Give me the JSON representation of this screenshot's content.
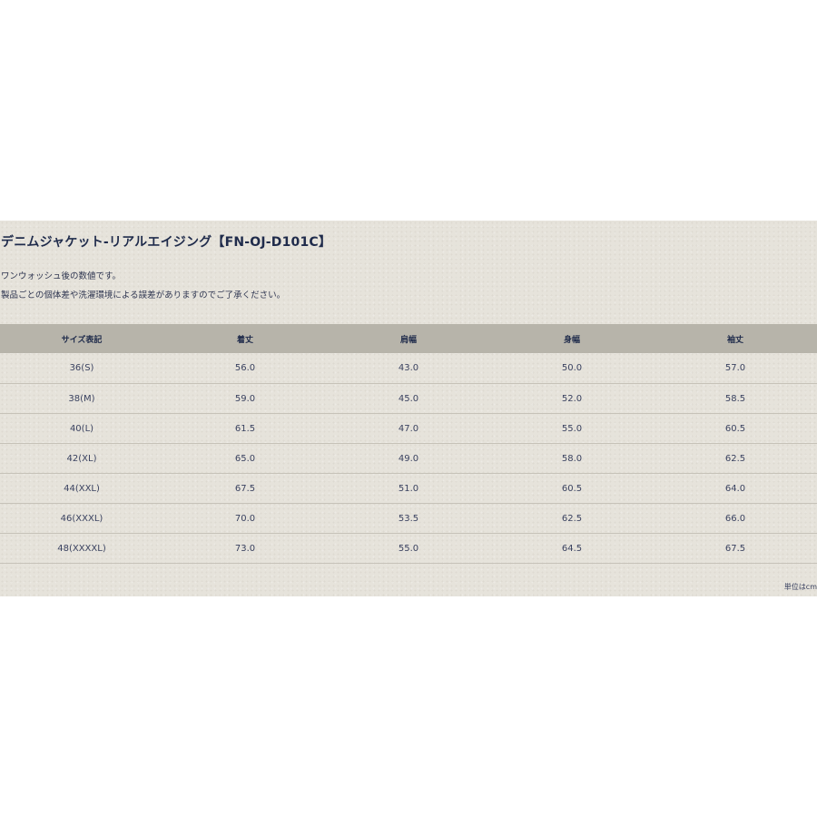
{
  "title": "デニムジャケット-リアルエイジング【FN-OJ-D101C】",
  "notes": [
    "ワンウォッシュ後の数値です。",
    "製品ごとの個体差や洗濯環境による誤差がありますのでご了承ください。"
  ],
  "table": {
    "headers": [
      "サイズ表記",
      "着丈",
      "肩幅",
      "身幅",
      "袖丈"
    ],
    "rows": [
      [
        "36(S)",
        "56.0",
        "43.0",
        "50.0",
        "57.0"
      ],
      [
        "38(M)",
        "59.0",
        "45.0",
        "52.0",
        "58.5"
      ],
      [
        "40(L)",
        "61.5",
        "47.0",
        "55.0",
        "60.5"
      ],
      [
        "42(XL)",
        "65.0",
        "49.0",
        "58.0",
        "62.5"
      ],
      [
        "44(XXL)",
        "67.5",
        "51.0",
        "60.5",
        "64.0"
      ],
      [
        "46(XXXL)",
        "70.0",
        "53.5",
        "62.5",
        "66.0"
      ],
      [
        "48(XXXXL)",
        "73.0",
        "55.0",
        "64.5",
        "67.5"
      ]
    ]
  },
  "unit_note": "単位はcm",
  "colors": {
    "background": "#e6e3db",
    "header_background": "#b7b4aa",
    "title_text": "#1f2b4b",
    "body_text": "#3a4260"
  }
}
